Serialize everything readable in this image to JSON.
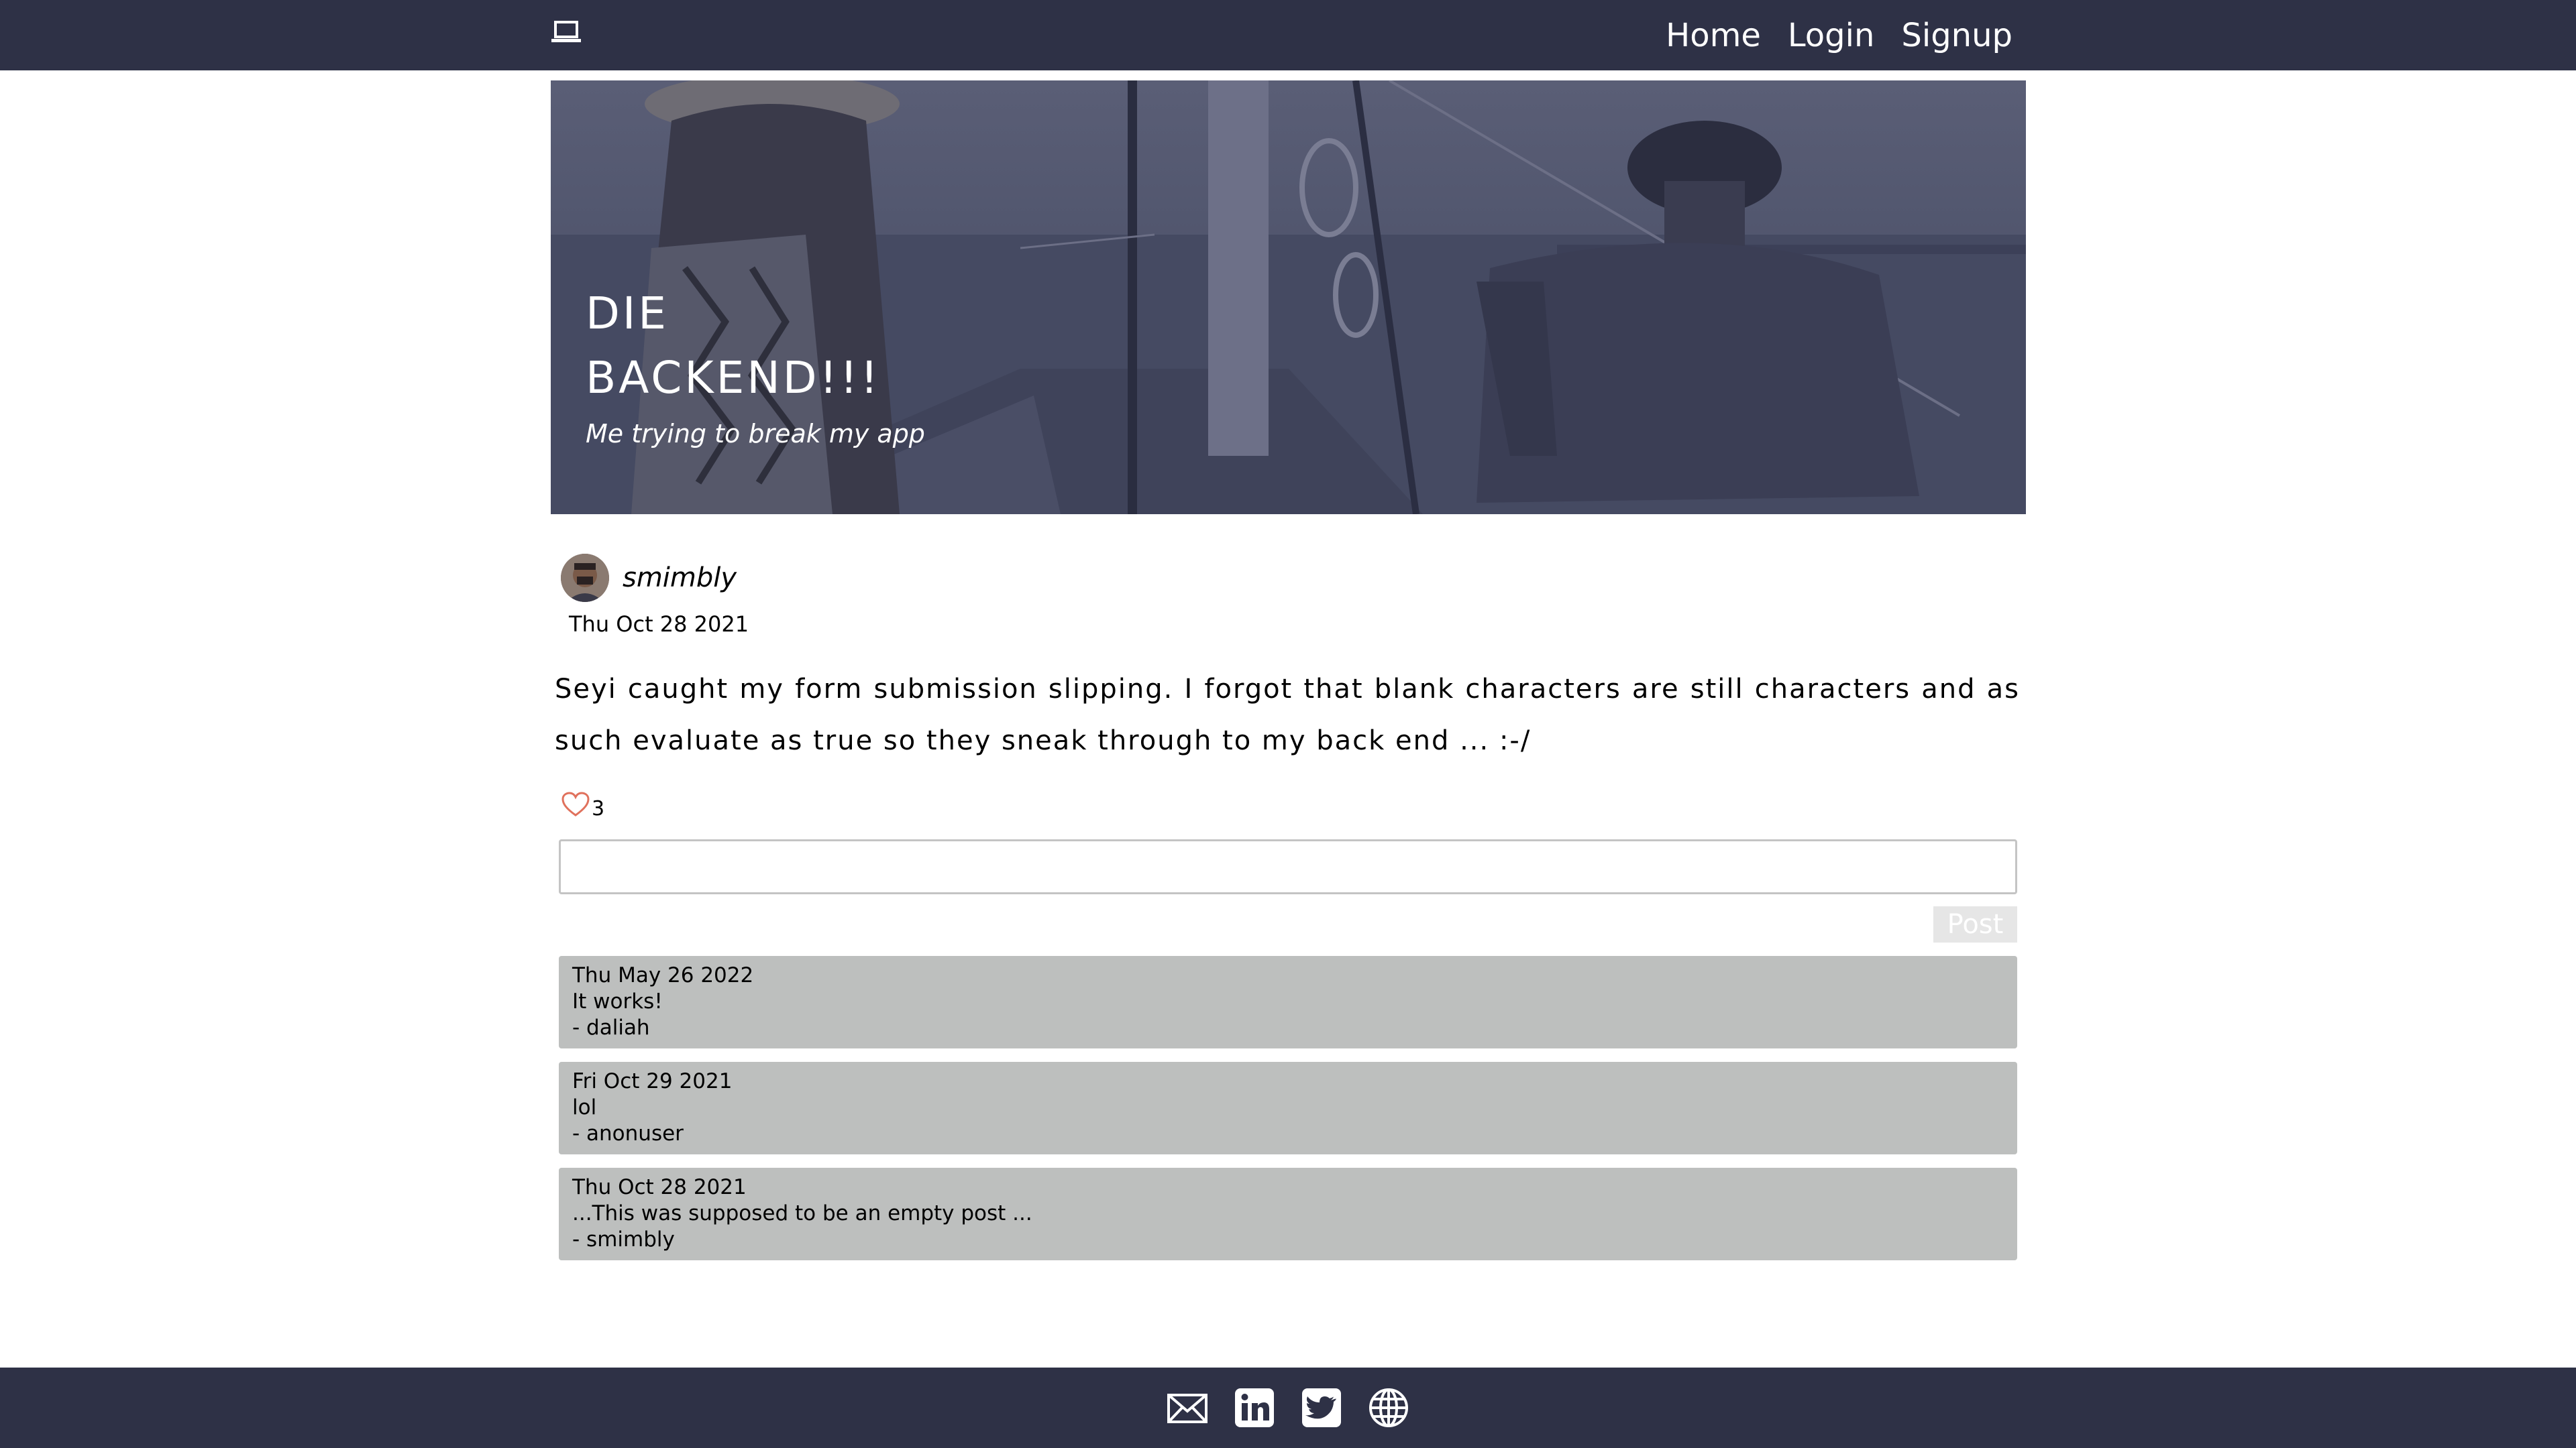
{
  "nav": {
    "logo_icon": "laptop-icon",
    "links": [
      {
        "label": "Home"
      },
      {
        "label": "Login"
      },
      {
        "label": "Signup"
      }
    ]
  },
  "hero": {
    "title": "DIE\nBACKEND!!!",
    "subtitle": "Me trying to break my app"
  },
  "post": {
    "author": "smimbly",
    "date": "Thu Oct 28 2021",
    "body": "Seyi caught my form submission slipping. I forgot that blank characters are still characters and as such evaluate as true so they sneak through to my back end ... :-/",
    "like_count": "3"
  },
  "comment_form": {
    "placeholder": "",
    "post_label": "Post"
  },
  "comments": [
    {
      "date": "Thu May 26 2022",
      "text": "It works!",
      "author": "- daliah"
    },
    {
      "date": "Fri Oct 29 2021",
      "text": "lol",
      "author": "- anonuser"
    },
    {
      "date": "Thu Oct 28 2021",
      "text": "...This was supposed to be an empty post ...",
      "author": "- smimbly"
    }
  ],
  "footer": {
    "icons": [
      "mail-icon",
      "linkedin-icon",
      "twitter-icon",
      "globe-icon"
    ]
  },
  "colors": {
    "nav_bg": "#2e3146",
    "comment_bg": "#bdbfbe",
    "heart": "#e0715c"
  }
}
